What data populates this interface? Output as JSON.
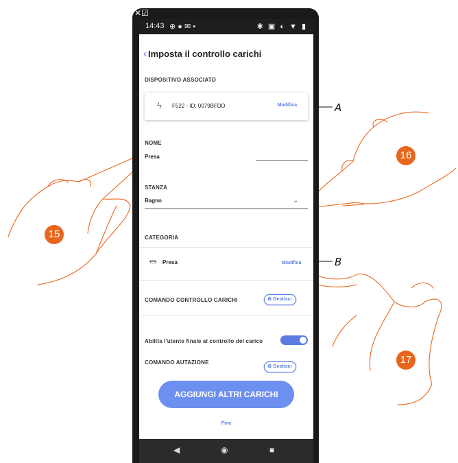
{
  "status_bar": {
    "time": "14:43",
    "left_icons": "⊕ ● ✉ •",
    "right_icons": "✱ ▣ ◐ ▼ ▮"
  },
  "top_icons": "✕☑",
  "header": {
    "back_glyph": "‹",
    "title": "Imposta il controllo carichi"
  },
  "device": {
    "section_label": "DISPOSITIVO ASSOCIATO",
    "bolt_glyph": "ϟ",
    "name": "F522 - ID: 0079BFDD",
    "edit_label": "Modifica"
  },
  "name_field": {
    "label": "NOME",
    "value": "Presa"
  },
  "room_field": {
    "label": "STANZA",
    "value": "Bagno"
  },
  "category": {
    "label": "CATEGORIA",
    "plug_glyph": "⏛",
    "value": "Presa",
    "edit_label": "Modifica"
  },
  "load_control": {
    "label": "COMANDO CONTROLLO CARICHI",
    "button_label": "Gestisci"
  },
  "enable_user": {
    "label": "Abilita l'utente finale al controllo del carico",
    "enabled": true
  },
  "automation": {
    "label": "COMANDO AUTAZIONE",
    "button_label": "Gestisci"
  },
  "add_button": "AGGIUNGI ALTRI CARICHI",
  "done_link": "Fine",
  "nav": {
    "back": "◀",
    "home": "◉",
    "recent": "■"
  },
  "annotations": {
    "callout_a": "A",
    "callout_b": "B",
    "step_15": "15",
    "step_16": "16",
    "step_17": "17"
  },
  "colors": {
    "accent": "#5a7be0",
    "button": "#6d8ff0",
    "badge": "#e8661c",
    "phone": "#1a1a1a"
  }
}
